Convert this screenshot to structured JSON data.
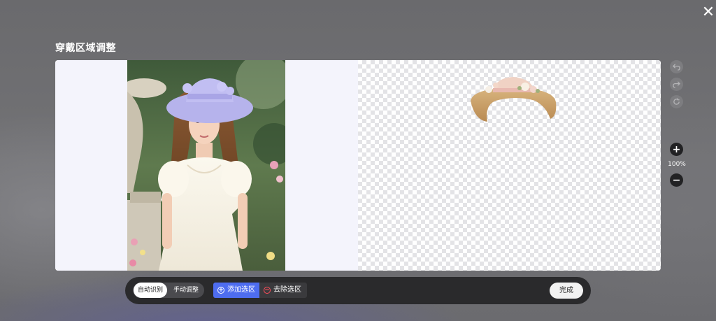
{
  "modal": {
    "title": "穿戴区域调整",
    "close_icon": "close-icon"
  },
  "canvas": {
    "source_image": "model-photo",
    "result_image": "hat-cutout-on-transparent"
  },
  "side_tools": {
    "undo_icon": "undo-icon",
    "redo_icon": "redo-icon",
    "reset_icon": "reset-icon",
    "zoom_in_icon": "plus-icon",
    "zoom_label": "100%",
    "zoom_out_icon": "minus-icon"
  },
  "toolbar": {
    "modes": [
      {
        "label": "自动识别",
        "active": true
      },
      {
        "label": "手动调整",
        "active": false
      }
    ],
    "add_selection": {
      "label": "添加选区",
      "icon": "plus-circle-icon"
    },
    "remove_selection": {
      "label": "去除选区",
      "icon": "minus-circle-icon"
    },
    "done_label": "完成"
  },
  "colors": {
    "accent": "#4e6df0",
    "remove": "#ff4d5a",
    "toolbar_bg": "#2a2a2c"
  }
}
